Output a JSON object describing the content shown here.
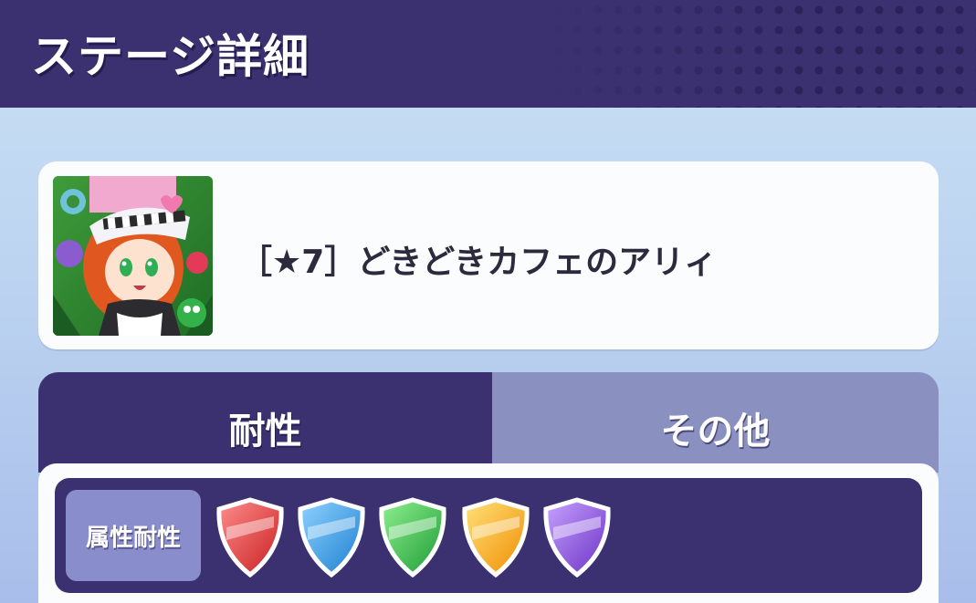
{
  "header": {
    "title": "ステージ詳細"
  },
  "stage": {
    "name": "［★7］どきどきカフェのアリィ",
    "thumbnail_icon": "character-portrait-icon"
  },
  "tabs": [
    {
      "label": "耐性",
      "active": true
    },
    {
      "label": "その他",
      "active": false
    }
  ],
  "resistance": {
    "label": "属性耐性",
    "shields": [
      {
        "icon": "red-shield-icon",
        "color": "#e53a3a"
      },
      {
        "icon": "blue-shield-icon",
        "color": "#2f9be0"
      },
      {
        "icon": "green-shield-icon",
        "color": "#2fae45"
      },
      {
        "icon": "yellow-shield-icon",
        "color": "#f5a80f"
      },
      {
        "icon": "purple-shield-icon",
        "color": "#8a4fd6"
      }
    ]
  },
  "colors": {
    "header_bg": "#3b3170",
    "tab_inactive_bg": "#8a91c1",
    "card_bg": "#fbfcfe"
  }
}
